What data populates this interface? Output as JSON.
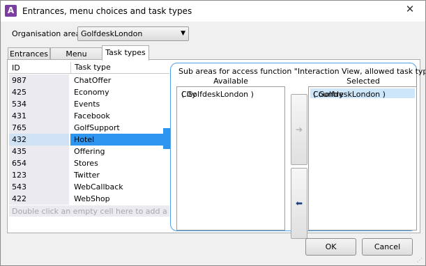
{
  "window": {
    "title": "Entrances, menu choices and task types",
    "close_glyph": "✕"
  },
  "organisation": {
    "label": "Organisation area",
    "selected": "GolfdeskLondon"
  },
  "tabs": [
    {
      "label": "Entrances",
      "active": false
    },
    {
      "label": "Menu choices",
      "active": false
    },
    {
      "label": "Task types",
      "active": true
    }
  ],
  "grid": {
    "columns": [
      "ID",
      "Task type"
    ],
    "rows": [
      {
        "id": "987",
        "task_type": "ChatOffer"
      },
      {
        "id": "425",
        "task_type": "Economy"
      },
      {
        "id": "534",
        "task_type": "Events"
      },
      {
        "id": "431",
        "task_type": "Facebook"
      },
      {
        "id": "765",
        "task_type": "GolfSupport"
      },
      {
        "id": "432",
        "task_type": "Hotel",
        "selected": true
      },
      {
        "id": "435",
        "task_type": "Offering"
      },
      {
        "id": "654",
        "task_type": "Stores"
      },
      {
        "id": "123",
        "task_type": "Twitter"
      },
      {
        "id": "543",
        "task_type": "WebCallback"
      },
      {
        "id": "422",
        "task_type": "WebShop"
      }
    ],
    "new_row_hint": "Double click an empty cell here to add a new"
  },
  "sub_areas": {
    "title": "Sub areas for access function \"Interaction View, allowed task types\"",
    "available_label": "Available",
    "selected_label": "Selected",
    "available": [
      {
        "name": "City",
        "org": "( GolfdeskLondon )"
      }
    ],
    "selected": [
      {
        "name": "Country",
        "org": "( GolfdeskLondon )"
      }
    ],
    "add_glyph": "➔",
    "remove_glyph": "⬅"
  },
  "buttons": {
    "ok": "OK",
    "cancel": "Cancel"
  },
  "colors": {
    "selection": "#2f96f0",
    "accent": "#7a3fa0"
  }
}
